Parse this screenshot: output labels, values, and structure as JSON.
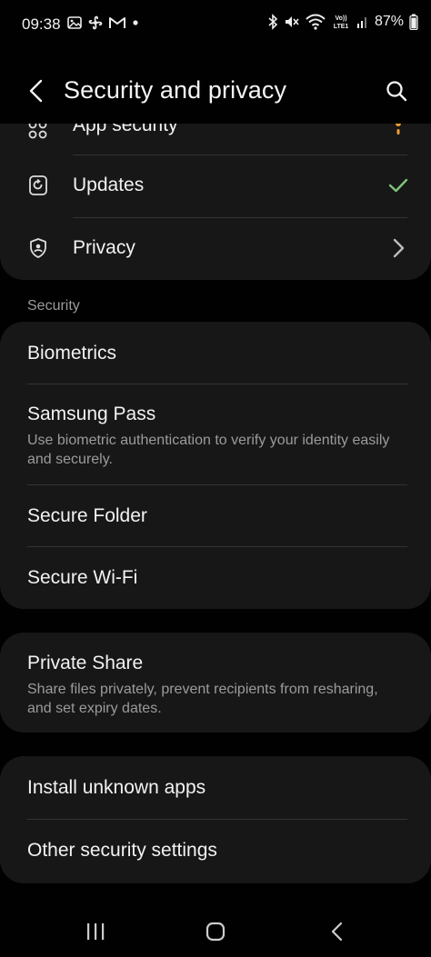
{
  "status_bar": {
    "time": "09:38",
    "battery_percent": "87%",
    "left_icons": [
      "gallery-icon",
      "fan-icon",
      "gmail-icon",
      "notification-dot-icon"
    ],
    "right_icons": [
      "bluetooth-icon",
      "mute-icon",
      "wifi-icon",
      "volte-icon",
      "signal-icon",
      "battery-icon"
    ],
    "volte_label": "Vo))\nLTE1"
  },
  "header": {
    "title": "Security and privacy",
    "back_icon": "chevron-left-icon",
    "search_icon": "search-icon"
  },
  "card_top": {
    "items": [
      {
        "label": "App security",
        "icon": "app-security-icon",
        "trailing": "warning-dot-icon"
      },
      {
        "label": "Updates",
        "icon": "update-icon",
        "trailing": "check-icon"
      },
      {
        "label": "Privacy",
        "icon": "shield-person-icon",
        "trailing": "chevron-right-icon"
      }
    ]
  },
  "security_section": {
    "label": "Security",
    "items": [
      {
        "label": "Biometrics"
      },
      {
        "label": "Samsung Pass",
        "sublabel": "Use biometric authentication to verify your identity easily and securely."
      },
      {
        "label": "Secure Folder"
      },
      {
        "label": "Secure Wi-Fi"
      }
    ]
  },
  "private_share": {
    "label": "Private Share",
    "sublabel": "Share files privately, prevent recipients from resharing, and set expiry dates."
  },
  "other_card": {
    "items": [
      {
        "label": "Install unknown apps"
      },
      {
        "label": "Other security settings"
      }
    ]
  },
  "colors": {
    "background": "#010101",
    "card": "#171717",
    "text": "#f2f2f2",
    "subtext": "#9b9b9b",
    "check_green": "#7fc47a",
    "warning_orange": "#f0a030"
  },
  "nav_bar": {
    "recents_icon": "recents-icon",
    "home_icon": "home-icon",
    "back_icon": "nav-back-icon"
  }
}
